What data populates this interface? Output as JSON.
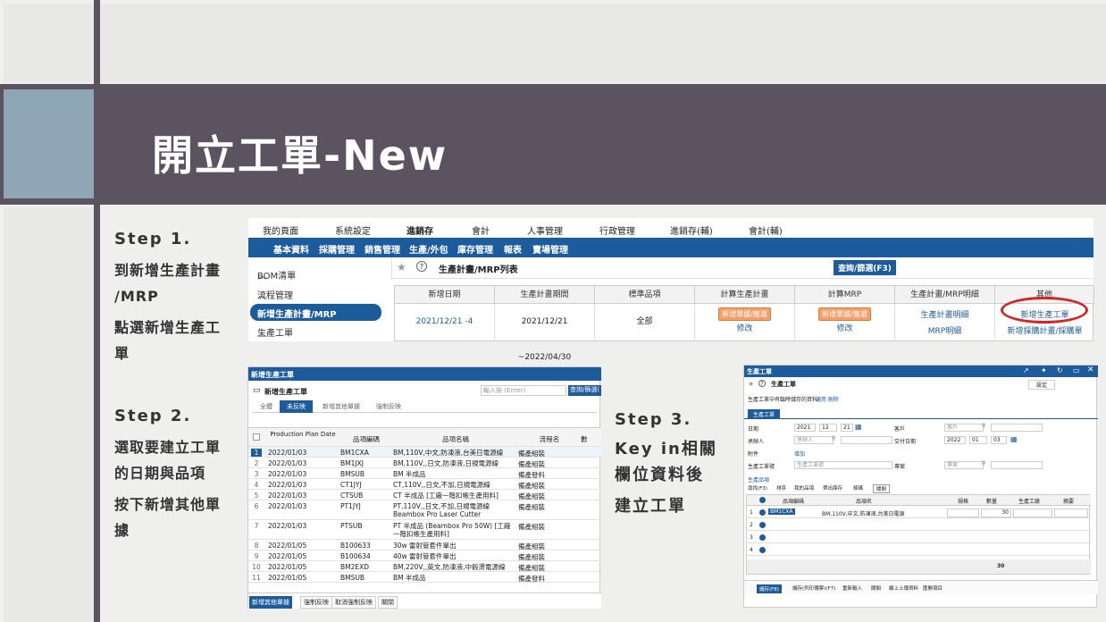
{
  "slide": {
    "title": "開立工單-New"
  },
  "steps": {
    "step1": {
      "label": "Step 1.",
      "line1": "到新增生產計畫",
      "line2": "/MRP",
      "line3": "點選新增生產工",
      "line4": "單"
    },
    "step2": {
      "label": "Step 2.",
      "line1": "選取要建立工單",
      "line2": "的日期與品項",
      "line3": "按下新增其他單",
      "line4": "據"
    },
    "step3": {
      "label": "Step 3.",
      "line1": "Key in相關",
      "line2": "欄位資料後",
      "line3": "建立工單"
    }
  },
  "ss1": {
    "topnav": [
      "我的頁面",
      "系統設定",
      "進銷存",
      "會計",
      "人事管理",
      "行政管理",
      "進銷存(輔)",
      "會計(輔)"
    ],
    "bluenav": [
      "基本資料",
      "採購管理",
      "銷售管理",
      "生產/外包",
      "庫存管理",
      "報表",
      "賣場管理"
    ],
    "sidebar": [
      "BOM清單",
      "流程管理",
      "新增生產計畫/MRP",
      "生產工單"
    ],
    "page_title": "生產計畫/MRP列表",
    "query_btn": "查詢/篩選(F3)",
    "headers": [
      "新增日期",
      "生產計畫期間",
      "標準品項",
      "計算生產計畫",
      "計算MRP",
      "生產計畫/MRP明細",
      "其他"
    ],
    "row": {
      "date": "2021/12/21 -4",
      "period": "2021/12/21 ~2022/04/30",
      "std": "全部",
      "calc_btn": "新增單據/應選",
      "calc_edit": "修改",
      "mrp_btn": "新增單據/應選",
      "mrp_edit": "修改",
      "detail1": "生產計畫明細",
      "detail2": "MRP明細",
      "other1": "新增生產工單",
      "other2": "新增採購計畫/採購單"
    }
  },
  "ss2": {
    "window_title": "新增生產工單",
    "page_title": "新增生產工單",
    "search_placeholder": "輸入後 (Enter)",
    "query_btn": "查詢/篩選(",
    "tabs": [
      "全體",
      "未反映",
      "新增其他單據",
      "強制反映"
    ],
    "headers": [
      "Production Plan Date",
      "品項編碼",
      "品項名稱",
      "流程名",
      "數"
    ],
    "rows": [
      [
        "1",
        "2022/01/03",
        "BM1CXA",
        "BM,110V,中文,防凍液,台美日電源線",
        "備產組裝"
      ],
      [
        "2",
        "2022/01/03",
        "BM1JXJ",
        "BM,110V,,日文,防凍液,日規電源線",
        "備產組裝"
      ],
      [
        "3",
        "2022/01/03",
        "BMSUB",
        "BM 半成品",
        "備產發料"
      ],
      [
        "4",
        "2022/01/03",
        "CT1JYJ",
        "CT,110V,,日文,不加,日規電源線",
        "備產組裝"
      ],
      [
        "5",
        "2022/01/03",
        "CTSUB",
        "CT 半成品 [工廠一階扣帳生產用料]",
        "備產組裝"
      ],
      [
        "6",
        "2022/01/03",
        "PT1JYJ",
        "PT,110V,,日文,不加,日規電源線 Beambox Pro Laser Cutter",
        "備產組裝"
      ],
      [
        "7",
        "2022/01/03",
        "PTSUB",
        "PT 半成品 (Beambox Pro 50W) [工廠一階扣帳生產用料]",
        "備產組裝"
      ],
      [
        "8",
        "2022/01/05",
        "B100633",
        "30w 雷射管套件單出",
        "備產組裝"
      ],
      [
        "9",
        "2022/01/05",
        "B100634",
        "40w 雷射管套件單出",
        "備產組裝"
      ],
      [
        "10",
        "2022/01/05",
        "BM2EXD",
        "BM,220V,,英文,防凍液,中穀燙電源線",
        "備產組裝"
      ],
      [
        "11",
        "2022/01/05",
        "BMSUB",
        "BM 半成品",
        "備產發料"
      ]
    ],
    "footer": [
      "新增其他單據",
      "強制反映",
      "取消強制反映",
      "關閉"
    ]
  },
  "ss3": {
    "window_title": "生產工單",
    "page_title": "生產工單",
    "settings": "設定",
    "note": "生產工單中有臨時儲存的資料。",
    "note_links": "適用 刪除",
    "tab": "生產工單",
    "fields": {
      "date_label": "日期",
      "year": "2021",
      "month": "12",
      "day": "21",
      "customer_label": "客戶",
      "customer_ph": "客戶",
      "requester_label": "承辦人",
      "requester_ph": "承辦人",
      "due_label": "交付日期",
      "due_year": "2022",
      "due_month": "01",
      "due_day": "03",
      "attach_label": "附件",
      "attach_link": "增加",
      "wo_label": "生產工單號",
      "wo_ph": "生產工單號",
      "project_label": "專案",
      "project_ph": "專案"
    },
    "section": "生產品項",
    "toolbar": [
      "尋找(F3)",
      "排序",
      "我的品項",
      "帶出庫存",
      "條碼",
      "關閉"
    ],
    "headers": [
      "品項編碼",
      "品項名",
      "規格",
      "數量",
      "生產工廠",
      "摘要"
    ],
    "row1": {
      "code": "BM1CXA",
      "name": "BM,110V,中文,防凍液,台美日電源",
      "qty": "30"
    },
    "total": "30",
    "footer": [
      "儲存(F8)",
      "儲存(列印傳票)(F7)",
      "重新輸入",
      "關閉",
      "線上上傳資料",
      "匯開項目"
    ]
  }
}
